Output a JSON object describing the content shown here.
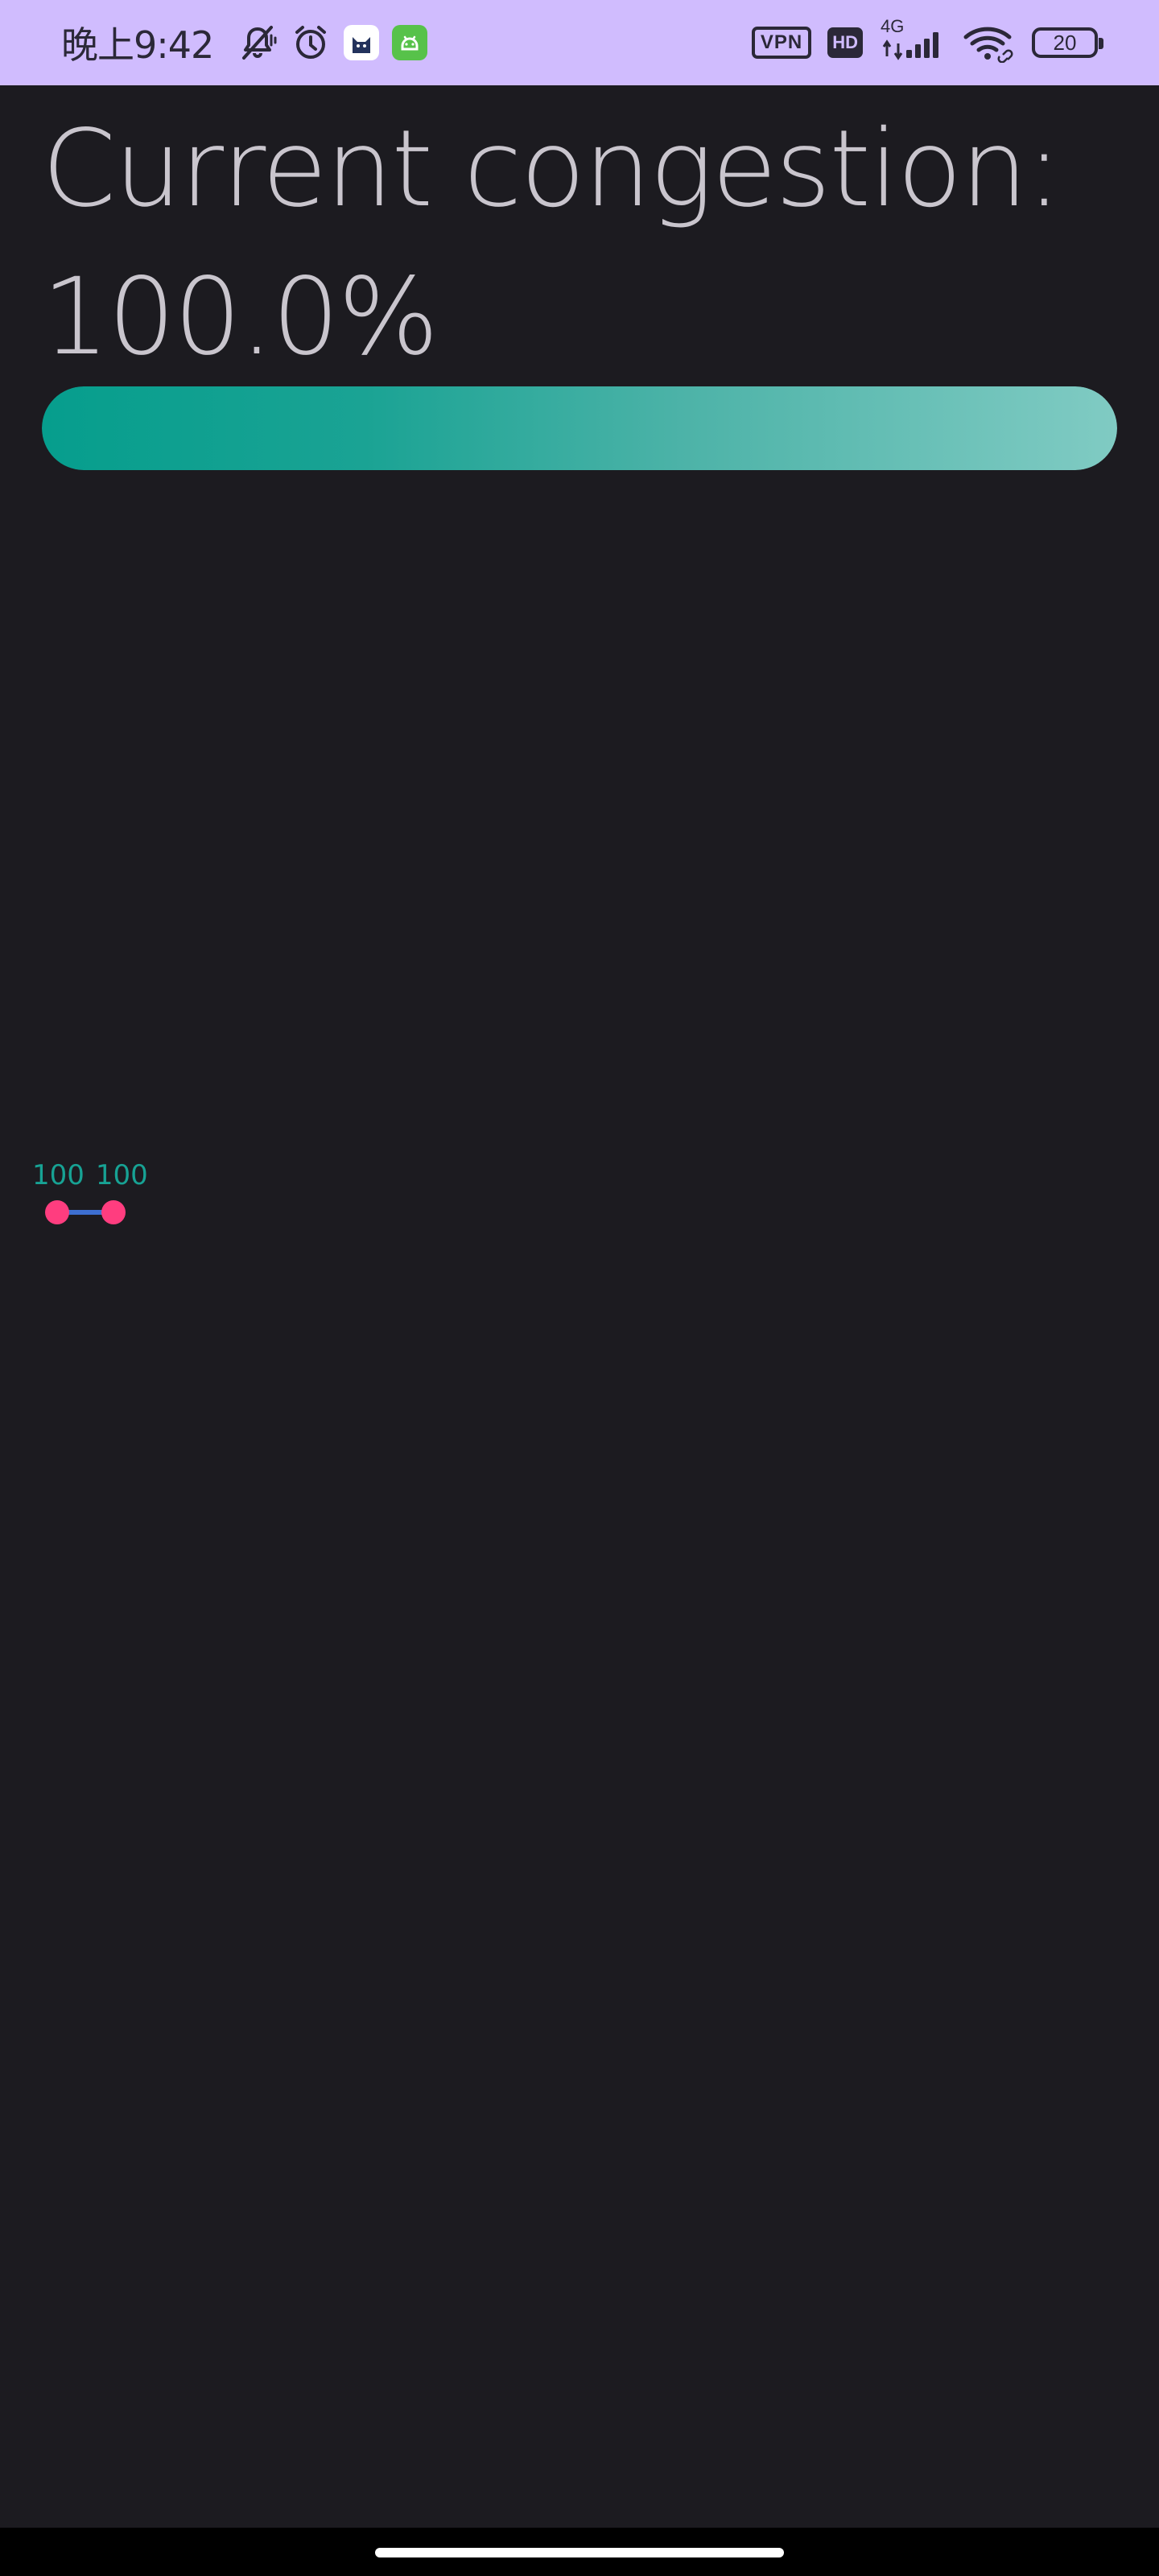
{
  "status_bar": {
    "time": "晚上9:42",
    "vpn_label": "VPN",
    "hd_label": "HD",
    "network_type": "4G",
    "battery_level": "20",
    "icons": [
      "mute-icon",
      "alarm-icon",
      "cat-app-icon",
      "android-app-icon",
      "vpn-icon",
      "hd-icon",
      "signal-icon",
      "wifi-icon",
      "battery-icon"
    ],
    "background_color": "#d0bcfe"
  },
  "main": {
    "congestion_label": "Current congestion: 100.0%",
    "progress": {
      "value_percent": 100,
      "gradient_start": "#069e8d",
      "gradient_end": "#80cbc3"
    },
    "range_slider": {
      "start_value": "100",
      "end_value": "100",
      "thumb_color": "#ff3d7f",
      "track_color": "#3d6fd1",
      "label_color": "#17a294"
    }
  },
  "theme": {
    "background": "#1c1b20",
    "text_color": "#c9c5cd"
  }
}
